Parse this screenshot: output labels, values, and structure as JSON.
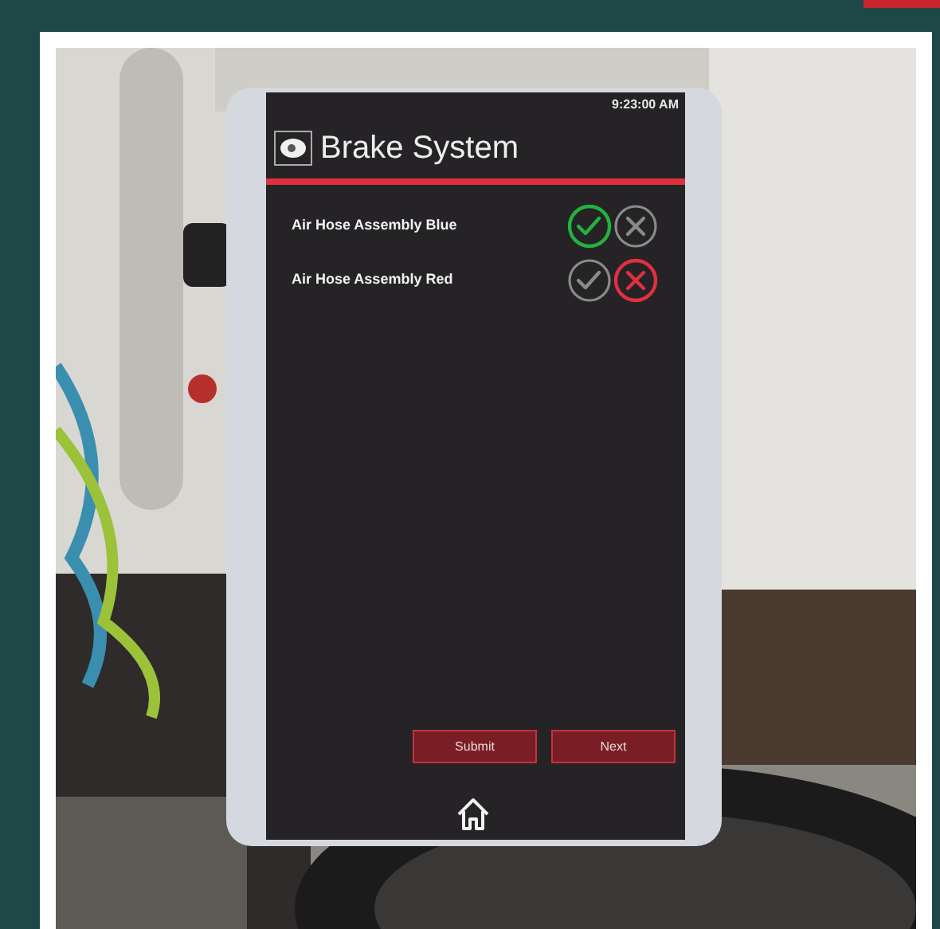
{
  "tablet": {
    "time": "9:23:00 AM",
    "title": "Brake System",
    "items": [
      {
        "label": "Air Hose Assembly Blue",
        "marks": [
          {
            "kind": "check",
            "selected": true
          },
          {
            "kind": "cross",
            "selected": false
          }
        ]
      },
      {
        "label": "Air Hose Assembly Red",
        "marks": [
          {
            "kind": "check",
            "selected": false
          },
          {
            "kind": "cross",
            "selected": true
          }
        ]
      }
    ],
    "buttons": [
      "Submit",
      "Next"
    ]
  }
}
